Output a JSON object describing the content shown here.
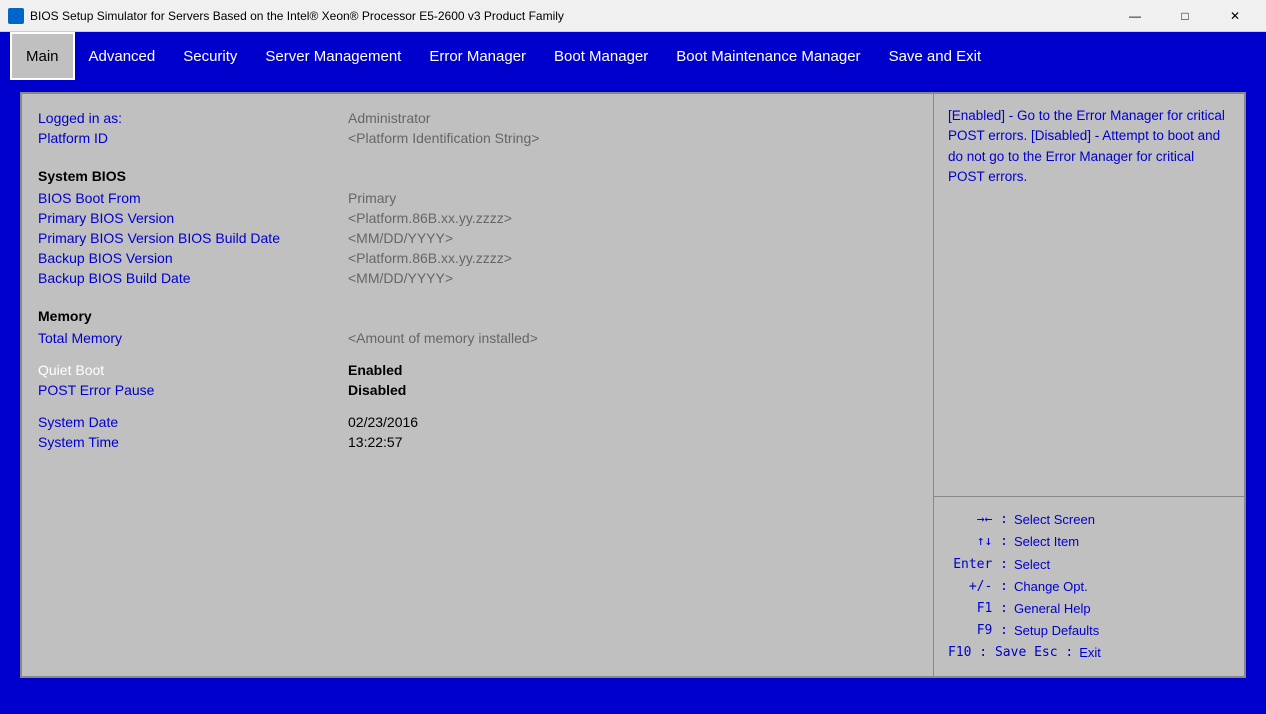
{
  "window": {
    "title": "BIOS Setup Simulator for Servers Based on the Intel® Xeon® Processor E5-2600 v3 Product Family",
    "controls": {
      "minimize": "—",
      "maximize": "□",
      "close": "✕"
    }
  },
  "nav": {
    "tabs": [
      {
        "id": "main",
        "label": "Main",
        "active": true
      },
      {
        "id": "advanced",
        "label": "Advanced",
        "active": false
      },
      {
        "id": "security",
        "label": "Security",
        "active": false
      },
      {
        "id": "server-management",
        "label": "Server Management",
        "active": false
      },
      {
        "id": "error-manager",
        "label": "Error Manager",
        "active": false
      },
      {
        "id": "boot-manager",
        "label": "Boot Manager",
        "active": false
      },
      {
        "id": "boot-maintenance",
        "label": "Boot Maintenance Manager",
        "active": false
      },
      {
        "id": "save-exit",
        "label": "Save and Exit",
        "active": false
      }
    ]
  },
  "main": {
    "rows": [
      {
        "label": "Logged in as:",
        "value": "Administrator",
        "label_color": "blue",
        "value_color": "gray"
      },
      {
        "label": "Platform ID",
        "value": "<Platform Identification String>",
        "label_color": "blue",
        "value_color": "gray"
      }
    ],
    "sections": [
      {
        "title": "System BIOS",
        "items": [
          {
            "label": "BIOS Boot From",
            "value": "Primary"
          },
          {
            "label": "Primary BIOS Version",
            "value": "<Platform.86B.xx.yy.zzzz>"
          },
          {
            "label": "Primary BIOS Version BIOS Build Date",
            "value": "<MM/DD/YYYY>"
          },
          {
            "label": "Backup BIOS Version",
            "value": "<Platform.86B.xx.yy.zzzz>"
          },
          {
            "label": "Backup BIOS Build Date",
            "value": "<MM/DD/YYYY>"
          }
        ]
      },
      {
        "title": "Memory",
        "items": [
          {
            "label": "Total Memory",
            "value": "<Amount of memory installed>"
          }
        ]
      }
    ],
    "standalone": [
      {
        "label": "Quiet Boot",
        "value": "Enabled",
        "value_bold": true
      },
      {
        "label": "POST Error Pause",
        "value": "Disabled",
        "value_bold": true
      }
    ],
    "datetime": [
      {
        "label": "System Date",
        "value": "02/23/2016"
      },
      {
        "label": "System Time",
        "value": "13:22:57"
      }
    ]
  },
  "help": {
    "text": "[Enabled] - Go to the Error Manager for critical POST errors. [Disabled] - Attempt to boot and do not go to the Error Manager for critical POST errors."
  },
  "keybindings": [
    {
      "symbol": "→←",
      "separator": " :  ",
      "desc": "Select Screen"
    },
    {
      "symbol": "↑↓",
      "separator": " :  ",
      "desc": "Select Item"
    },
    {
      "symbol": "Enter",
      "separator": " :  ",
      "desc": "Select"
    },
    {
      "symbol": "+/-",
      "separator": " :  ",
      "desc": "Change Opt."
    },
    {
      "symbol": "F1",
      "separator": " :  ",
      "desc": "General Help"
    },
    {
      "symbol": "F9",
      "separator": " :  ",
      "desc": "Setup Defaults"
    },
    {
      "symbol": "F10",
      "separator": " :  Save    Esc :  ",
      "desc": "Exit"
    }
  ]
}
